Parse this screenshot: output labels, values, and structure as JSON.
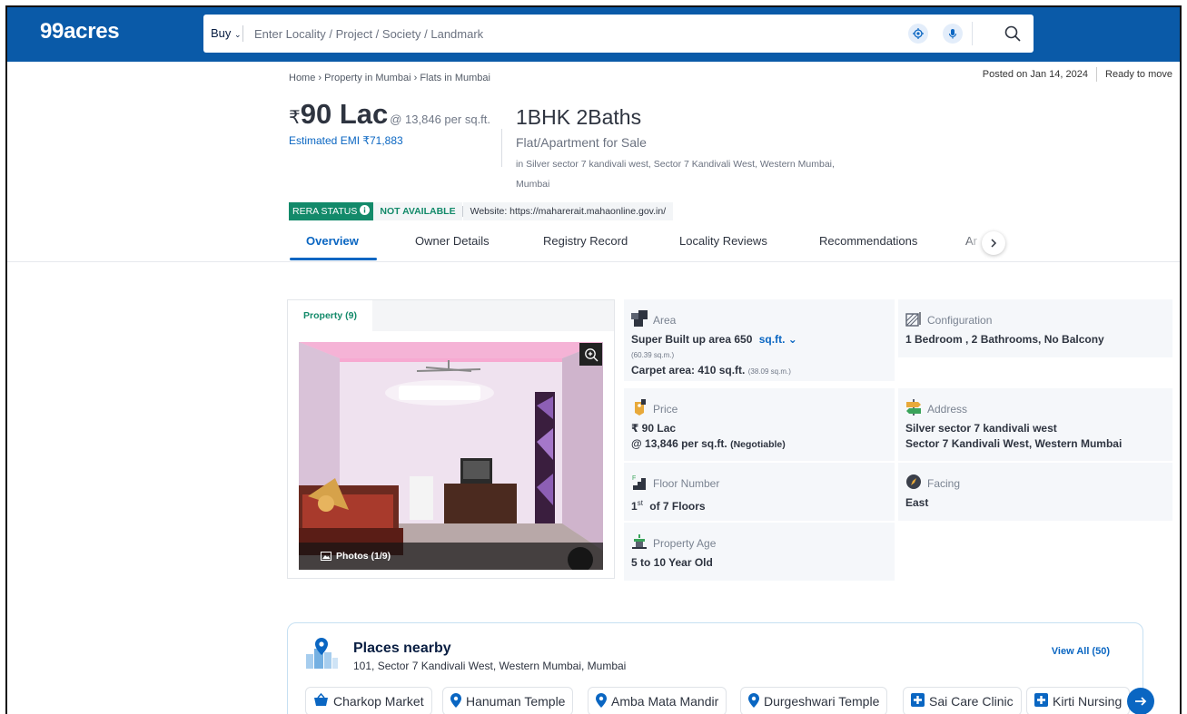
{
  "header": {
    "logo": "99acres",
    "buy_label": "Buy",
    "search_placeholder": "Enter Locality / Project / Society / Landmark",
    "icons": [
      "location-target-icon",
      "microphone-icon",
      "search-icon"
    ]
  },
  "breadcrumb": {
    "items": [
      "Home",
      "Property in Mumbai",
      "Flats in Mumbai"
    ],
    "separator": "›"
  },
  "posting": {
    "posted": "Posted on Jan 14, 2024",
    "status": "Ready to move"
  },
  "listing": {
    "currency": "₹",
    "price": "90 Lac",
    "price_per_sqft": "@ 13,846 per sq.ft.",
    "emi": "Estimated EMI ₹71,883",
    "title": "1BHK 2Baths",
    "type": "Flat/Apartment for Sale",
    "address": "in Silver sector 7 kandivali west, Sector 7 Kandivali West, Western Mumbai, Mumbai"
  },
  "rera": {
    "label": "RERA STATUS",
    "status": "NOT AVAILABLE",
    "website": "Website: https://maharerait.mahaonline.gov.in/",
    "accent": "#138a6a"
  },
  "tabs": [
    "Overview",
    "Owner Details",
    "Registry Record",
    "Locality Reviews",
    "Recommendations",
    "Ar"
  ],
  "gallery": {
    "tab_label": "Property (9)",
    "photos_label": "Photos (1/9)"
  },
  "details": {
    "area": {
      "label": "Area",
      "super_built": "Super Built up area 650",
      "unit": "sq.ft.",
      "super_built_sqm": "(60.39 sq.m.)",
      "carpet": "Carpet area: 410 sq.ft.",
      "carpet_sqm": "(38.09 sq.m.)"
    },
    "configuration": {
      "label": "Configuration",
      "value": "1 Bedroom , 2 Bathrooms, No Balcony"
    },
    "price": {
      "label": "Price",
      "value": "₹ 90 Lac",
      "per": "@ 13,846 per sq.ft.",
      "note": "(Negotiable)"
    },
    "address": {
      "label": "Address",
      "line1": "Silver sector 7 kandivali west",
      "line2": "Sector 7 Kandivali West, Western Mumbai"
    },
    "floor": {
      "label": "Floor Number",
      "num": "1",
      "sup": "st",
      "rest": "of 7 Floors"
    },
    "facing": {
      "label": "Facing",
      "value": "East"
    },
    "age": {
      "label": "Property Age",
      "value": "5 to 10 Year Old"
    }
  },
  "nearby": {
    "title": "Places nearby",
    "address": "101, Sector 7 Kandivali West, Western Mumbai, Mumbai",
    "view_all": "View All (50)",
    "places": [
      {
        "name": "Charkop Market",
        "icon": "basket-icon"
      },
      {
        "name": "Hanuman Temple",
        "icon": "location-pin-icon"
      },
      {
        "name": "Amba Mata Mandir",
        "icon": "location-pin-icon"
      },
      {
        "name": "Durgeshwari Temple",
        "icon": "location-pin-icon"
      },
      {
        "name": "Sai Care Clinic",
        "icon": "hospital-cross-icon"
      },
      {
        "name": "Kirti Nursing",
        "icon": "hospital-cross-icon"
      }
    ]
  },
  "colors": {
    "brand": "#0a5aa8",
    "link": "#0a66c2",
    "green": "#138a6a",
    "cell_bg": "#f5f7fa"
  }
}
